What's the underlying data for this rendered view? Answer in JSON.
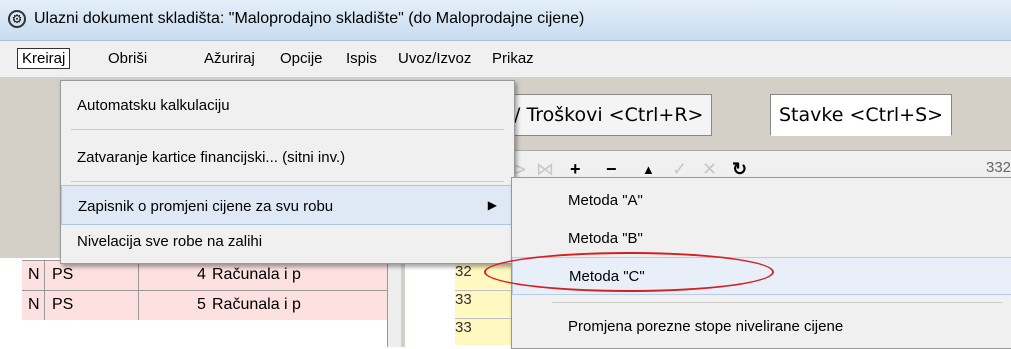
{
  "window": {
    "title": "Ulazni dokument skladišta: \"Maloprodajno skladište\"  (do Maloprodajne cijene)",
    "icon": "gear-icon"
  },
  "menubar": {
    "items": [
      "Kreiraj",
      "Obriši",
      "Ažuriraj",
      "Opcije",
      "Ispis",
      "Uvoz/Izvoz",
      "Prikaz"
    ]
  },
  "tabs": {
    "troskovi": "/ Troškovi <Ctrl+R>",
    "stavke": "Stavke <Ctrl+S>"
  },
  "toolbar": {
    "icons": [
      "nav-prev-icon",
      "nav-next-icon",
      "add-icon",
      "remove-icon",
      "up-icon",
      "check-icon",
      "cancel-icon",
      "refresh-icon"
    ],
    "counter": "332"
  },
  "menu": {
    "items": [
      "Automatsku kalkulaciju",
      "Zatvaranje kartice financijski... (sitni inv.)",
      "Zapisnik o promjeni cijene za svu robu",
      "Nivelacija sve robe na zalihi"
    ],
    "highlighted_index": 2
  },
  "submenu": {
    "items": [
      "Metoda \"A\"",
      "Metoda \"B\"",
      "Metoda \"C\"",
      "Promjena porezne stope nivelirane cijene"
    ],
    "highlighted_index": 2
  },
  "grid": {
    "rows": [
      {
        "c1": "N",
        "c2": "PS",
        "c3": "4",
        "c4": "Računala i p"
      },
      {
        "c1": "N",
        "c2": "PS",
        "c3": "5",
        "c4": "Računala i p"
      }
    ],
    "right_cells": [
      "32",
      "33",
      "33"
    ]
  },
  "colors": {
    "highlight_ellipse": "#d42020",
    "row_pink": "#fde0e0",
    "cell_yellow": "#fff8c0"
  }
}
